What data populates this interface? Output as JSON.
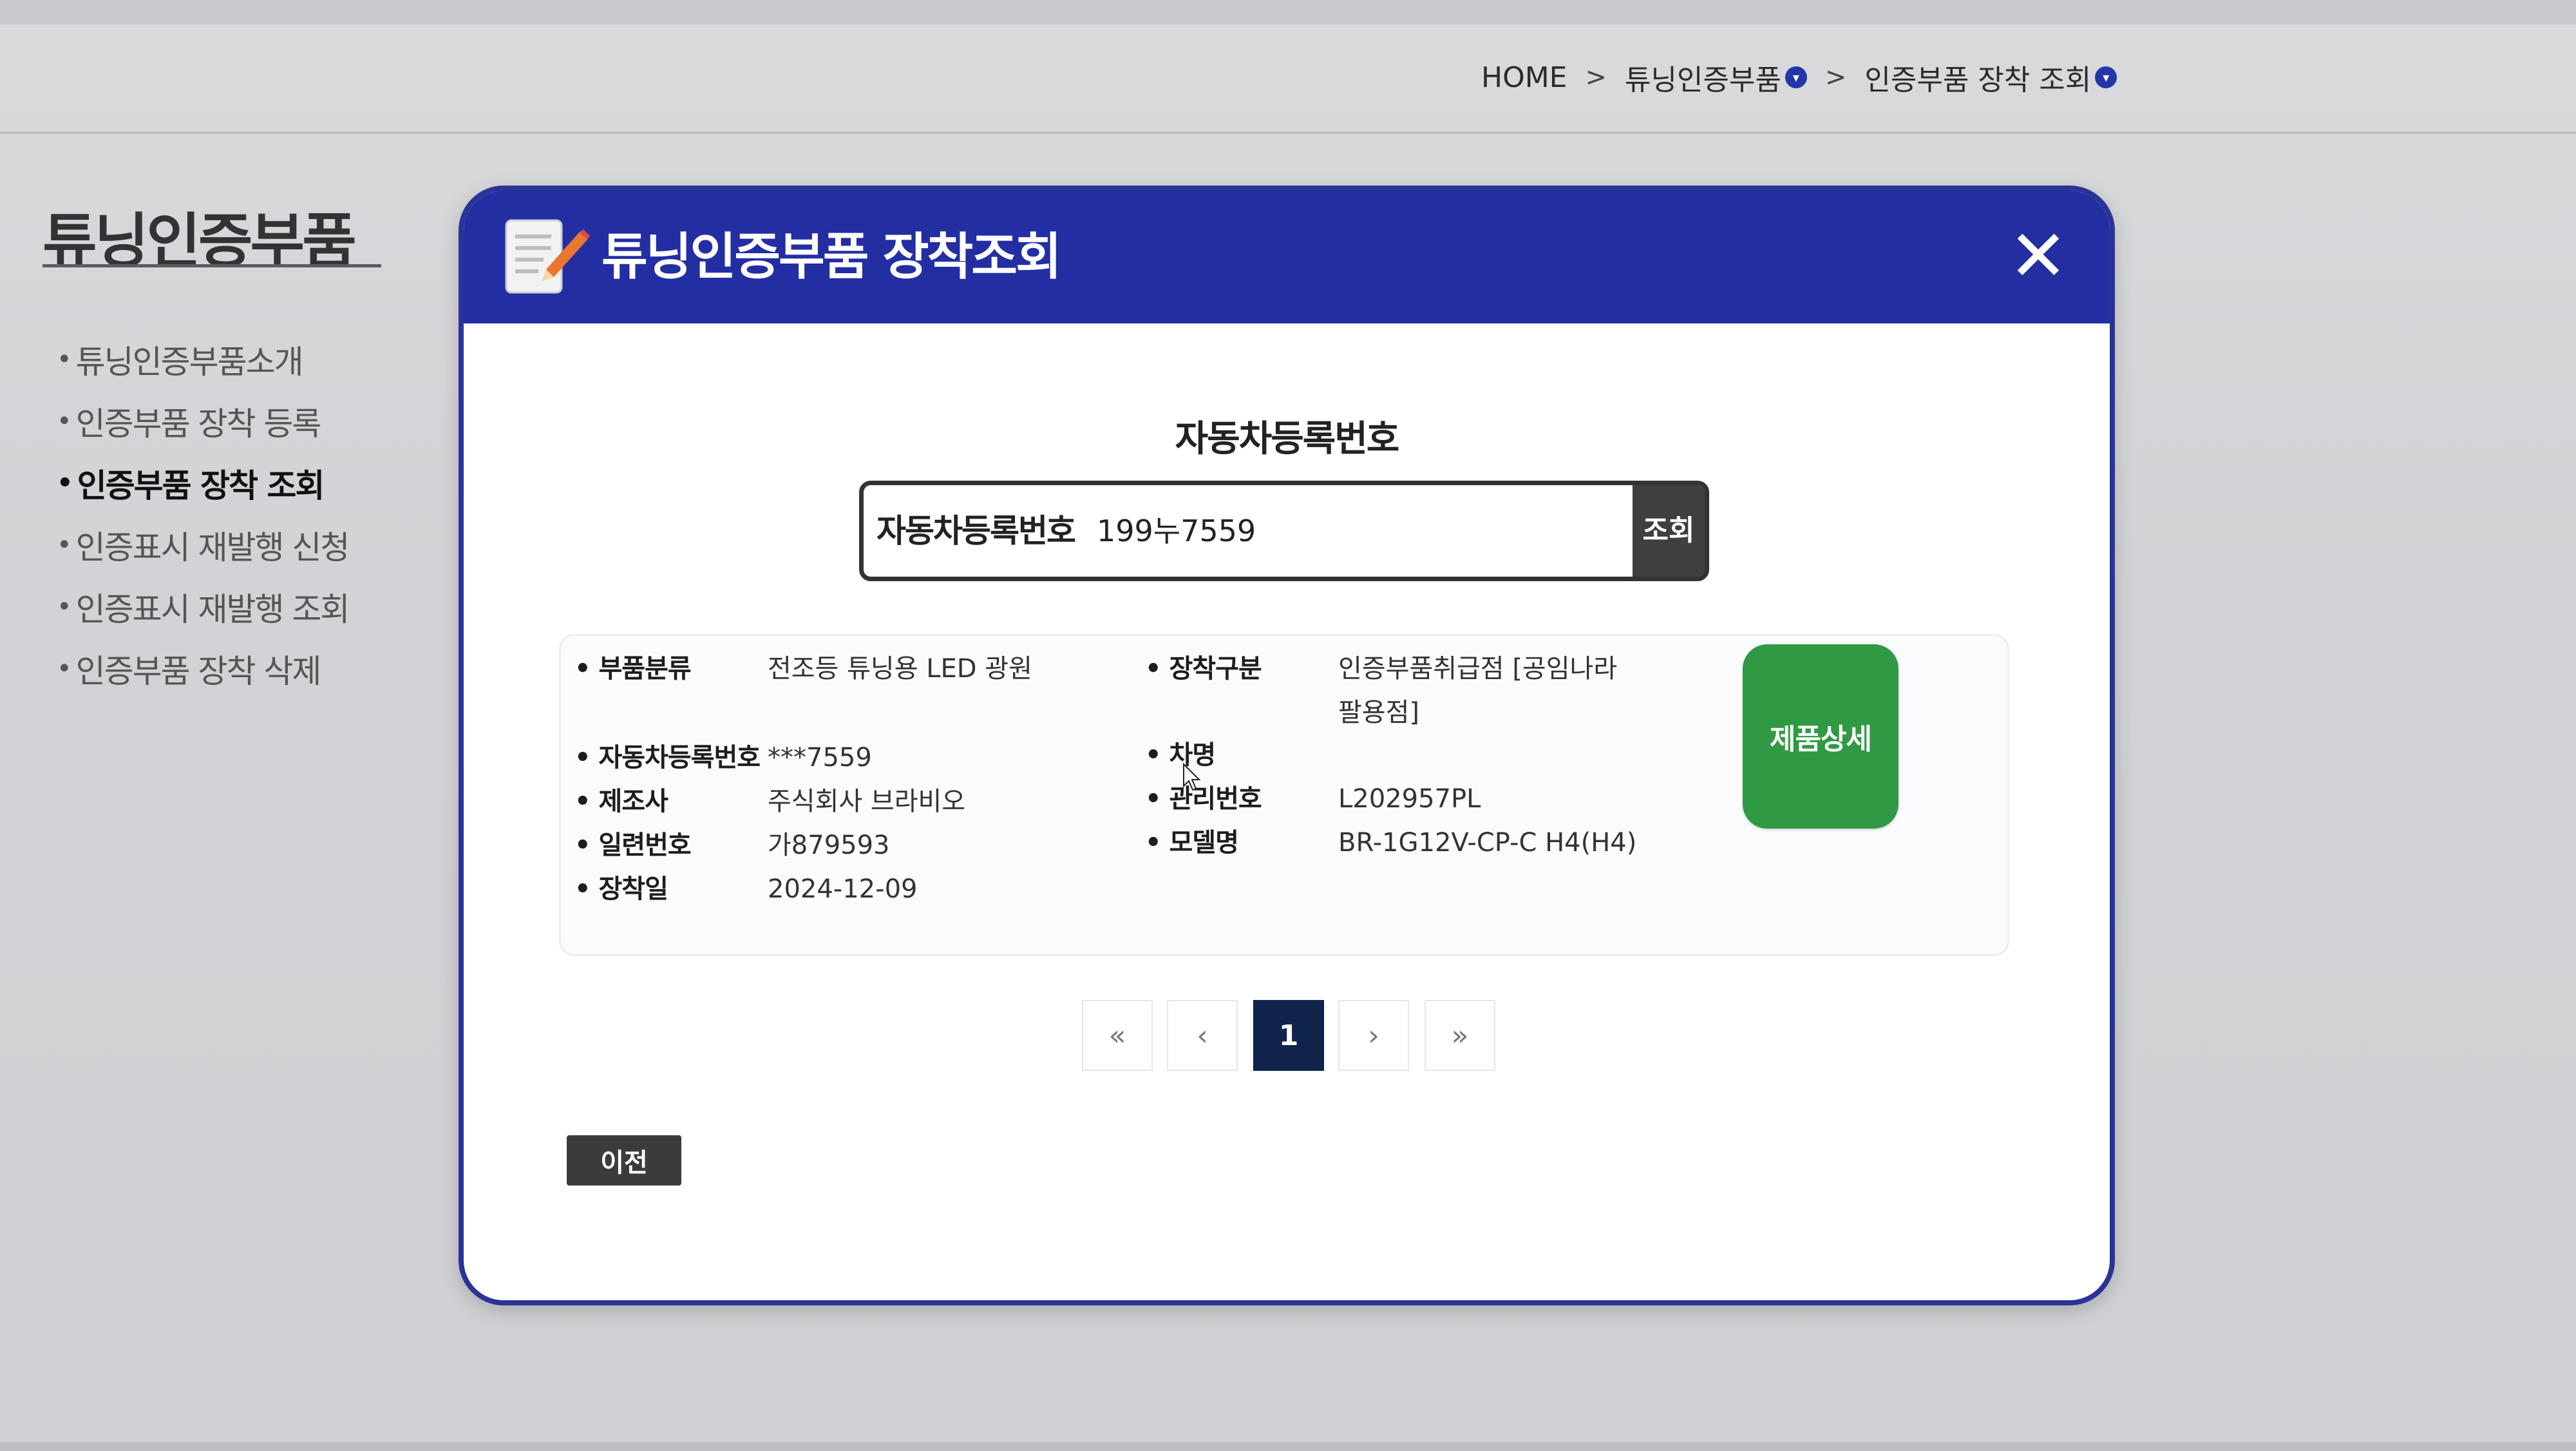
{
  "breadcrumb": {
    "home": "HOME",
    "sep1": ">",
    "level1": "튜닝인증부품",
    "sep2": ">",
    "level2": "인증부품 장착 조회"
  },
  "sidebar": {
    "title": "튜닝인증부품",
    "items": [
      {
        "label": "튜닝인증부품소개",
        "active": false
      },
      {
        "label": "인증부품 장착 등록",
        "active": false
      },
      {
        "label": "인증부품 장착 조회",
        "active": true
      },
      {
        "label": "인증표시 재발행 신청",
        "active": false
      },
      {
        "label": "인증표시 재발행 조회",
        "active": false
      },
      {
        "label": "인증부품 장착 삭제",
        "active": false
      }
    ]
  },
  "modal": {
    "title": "튜닝인증부품 장착조회",
    "close_icon": "close-icon",
    "section_label": "자동차등록번호",
    "search": {
      "label": "자동차등록번호",
      "value": "199누7559",
      "button": "조회"
    },
    "result": {
      "category_key": "부품분류",
      "category_val": "전조등 튜닝용 LED 광원",
      "install_type_key": "장착구분",
      "install_type_val_line1": "인증부품취급점 [공임나라",
      "install_type_val_line2": "팔용점]",
      "reg_no_key": "자동차등록번호",
      "reg_no_val": "***7559",
      "car_name_key": "차명",
      "car_name_val": "",
      "maker_key": "제조사",
      "maker_val": "주식회사 브라비오",
      "mgmt_no_key": "관리번호",
      "mgmt_no_val": "L202957PL",
      "serial_key": "일련번호",
      "serial_val": "가879593",
      "model_key": "모델명",
      "model_val": "BR-1G12V-CP-C H4(H4)",
      "date_key": "장착일",
      "date_val": "2024-12-09"
    },
    "detail_button": "제품상세",
    "pagination": {
      "first": "«",
      "prev": "‹",
      "current": "1",
      "next": "›",
      "last": "»"
    },
    "back_button": "이전"
  },
  "colors": {
    "header_blue": "#232ea3",
    "detail_green": "#2f9a43",
    "page_active": "#10234a"
  }
}
